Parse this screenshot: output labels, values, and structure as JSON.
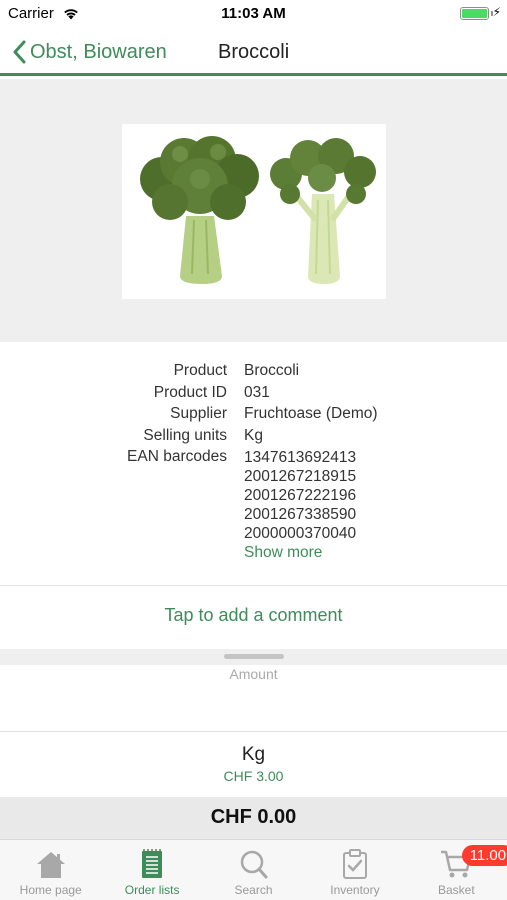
{
  "status_bar": {
    "carrier": "Carrier",
    "time": "11:03 AM",
    "battery_level": 1.0
  },
  "nav": {
    "back_label": "Obst, Biowaren",
    "title": "Broccoli",
    "accent_color": "#3f8b5a"
  },
  "product": {
    "image_alt": "Broccoli",
    "fields": [
      {
        "label": "Product",
        "value": "Broccoli"
      },
      {
        "label": "Product ID",
        "value": "031"
      },
      {
        "label": "Supplier",
        "value": "Fruchtoase (Demo)"
      },
      {
        "label": "Selling units",
        "value": "Kg"
      }
    ],
    "ean_label": "EAN barcodes",
    "ean_barcodes": [
      "1347613692413",
      "2001267218915",
      "2001267222196",
      "2001267338590",
      "2000000370040"
    ],
    "show_more": "Show more"
  },
  "comment": {
    "label": "Tap to add a comment"
  },
  "order": {
    "amount_placeholder": "Amount",
    "amount_value": "",
    "unit": "Kg",
    "unit_price": "CHF 3.00",
    "total": "CHF 0.00"
  },
  "tabs": [
    {
      "label": "Home page",
      "icon": "home-icon",
      "active": false
    },
    {
      "label": "Order lists",
      "icon": "order-list-icon",
      "active": true
    },
    {
      "label": "Search",
      "icon": "search-icon",
      "active": false
    },
    {
      "label": "Inventory",
      "icon": "inventory-icon",
      "active": false
    },
    {
      "label": "Basket",
      "icon": "basket-icon",
      "active": false,
      "badge": "11.00"
    }
  ]
}
